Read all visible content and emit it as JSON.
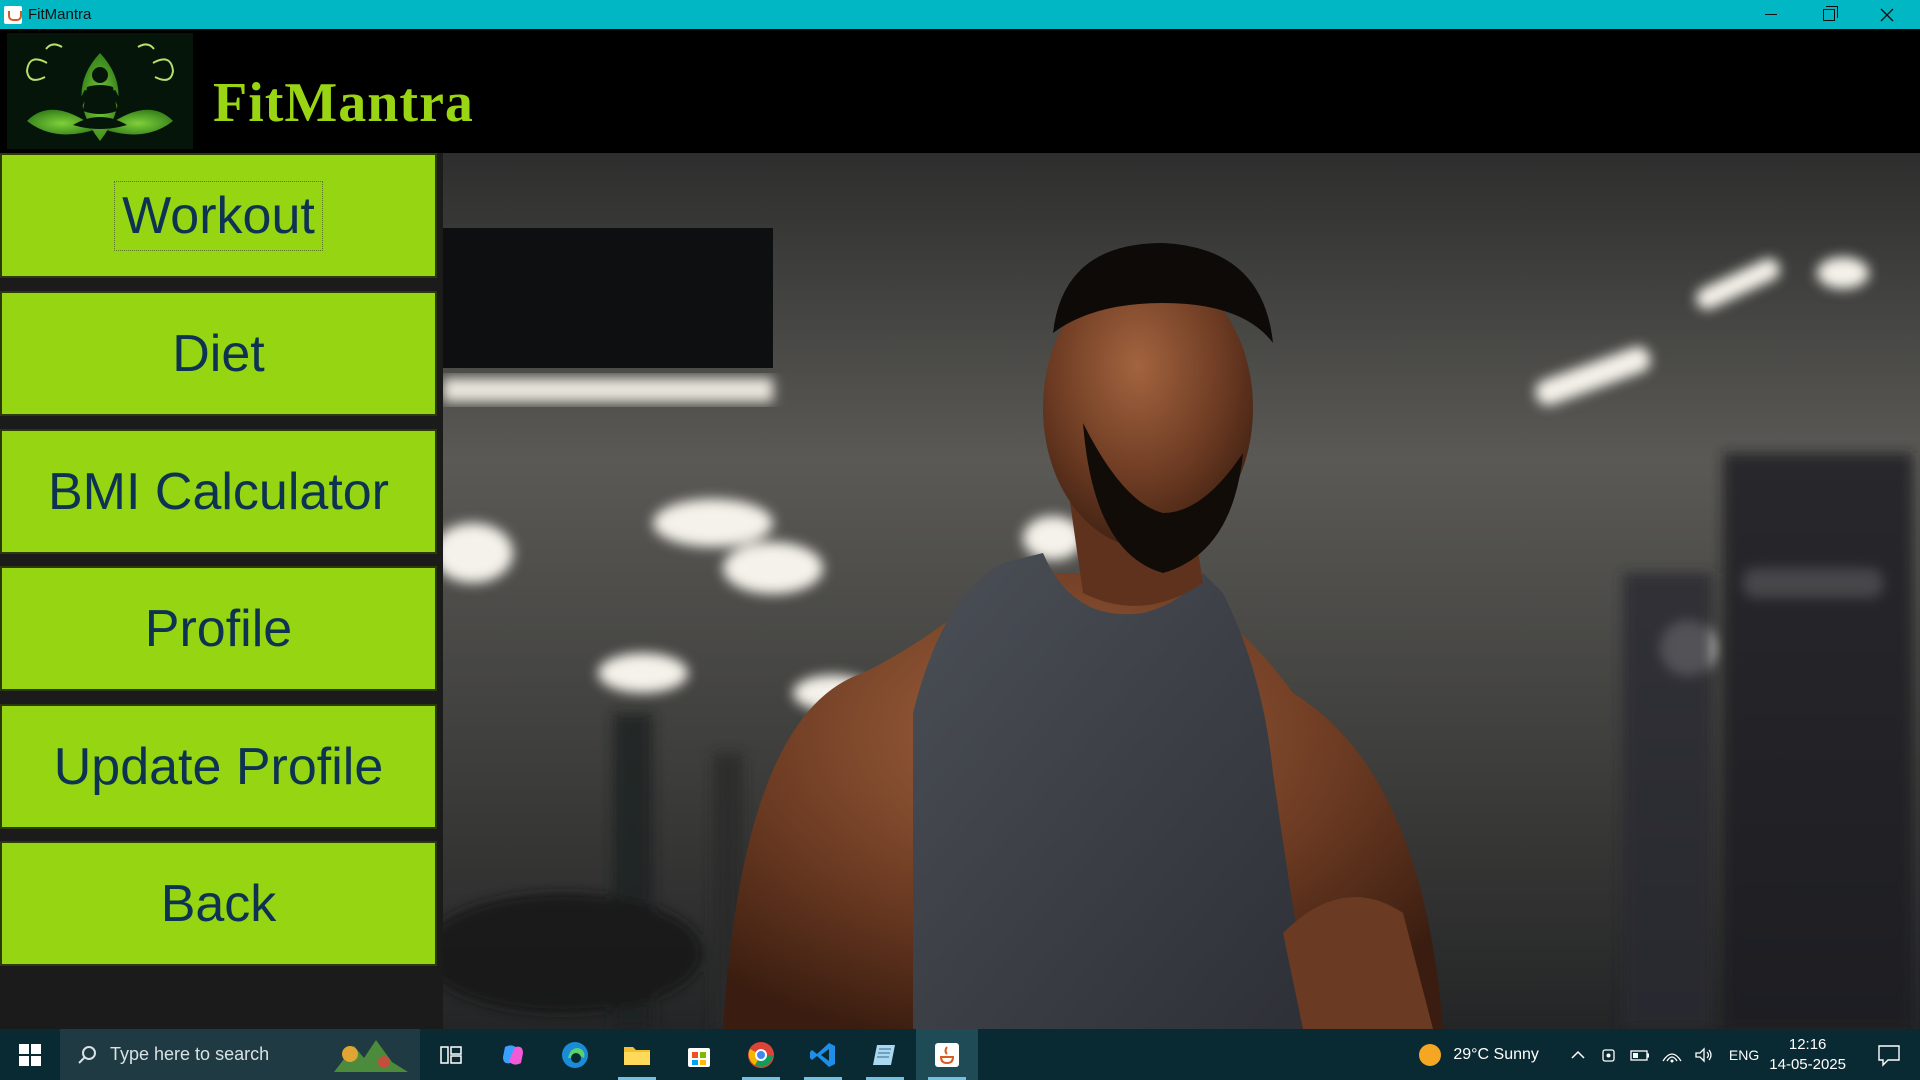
{
  "window": {
    "title": "FitMantra",
    "minimize_label": "Minimize",
    "maximize_label": "Restore",
    "close_label": "Close"
  },
  "header": {
    "brand": "FitMantra"
  },
  "nav": {
    "items": [
      {
        "label": "Workout"
      },
      {
        "label": "Diet"
      },
      {
        "label": "BMI Calculator"
      },
      {
        "label": "Profile"
      },
      {
        "label": "Update Profile"
      },
      {
        "label": "Back"
      }
    ]
  },
  "taskbar": {
    "search_placeholder": "Type here to search",
    "apps": [
      "task-view",
      "copilot",
      "edge",
      "file-explorer",
      "microsoft-store",
      "chrome",
      "vscode",
      "notepad",
      "java"
    ],
    "weather": "29°C  Sunny",
    "language": "ENG",
    "time": "12:16",
    "date": "14-05-2025"
  },
  "colors": {
    "accent": "#95d511",
    "brand_text": "#9ad514",
    "button_text": "#0e3352",
    "titlebar": "#00b7c3"
  }
}
